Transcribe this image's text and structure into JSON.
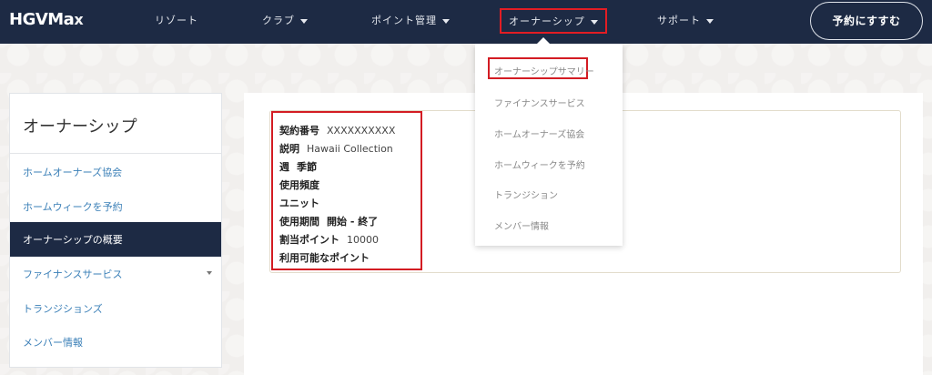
{
  "header": {
    "logo_main": "HGVMa",
    "logo_x": "x",
    "nav": [
      "リゾート",
      "クラブ",
      "ポイント管理",
      "オーナーシップ",
      "サポート"
    ],
    "reserve_label": "予約にすすむ"
  },
  "dropdown": {
    "items": [
      "オーナーシップサマリー",
      "ファイナンスサービス",
      "ホームオーナーズ協会",
      "ホームウィークを予約",
      "トランジション",
      "メンバー情報"
    ]
  },
  "sidebar": {
    "title": "オーナーシップ",
    "items": [
      "ホームオーナーズ協会",
      "ホームウィークを予約",
      "オーナーシップの概要",
      "ファイナンスサービス",
      "トランジションズ",
      "メンバー情報"
    ]
  },
  "info": {
    "rows": [
      {
        "label": "契約番号",
        "value": "XXXXXXXXXX"
      },
      {
        "label": "説明",
        "value": "Hawaii Collection"
      },
      {
        "label": "週",
        "value": "季節"
      },
      {
        "label": "使用頻度",
        "value": ""
      },
      {
        "label": "ユニット",
        "value": ""
      },
      {
        "label": "使用期間",
        "value": "開始 - 終了"
      },
      {
        "label": "割当ポイント",
        "value": "10000"
      },
      {
        "label": "利用可能なポイント",
        "value": ""
      }
    ]
  },
  "colors": {
    "navbar": "#1d2a44",
    "highlight_red": "#d31c23",
    "link_blue": "#3a7fb7"
  }
}
